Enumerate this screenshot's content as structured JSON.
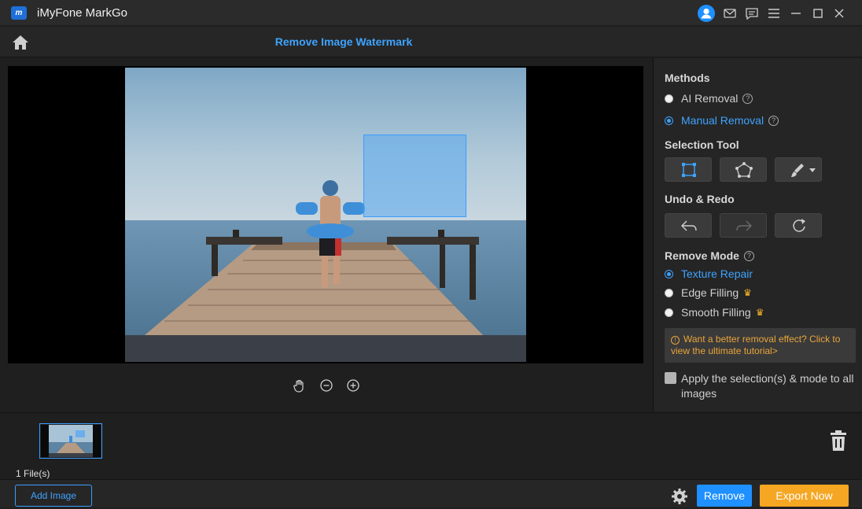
{
  "app": {
    "title": "iMyFone MarkGo",
    "logo_text": "m"
  },
  "header": {
    "title": "Remove Image Watermark"
  },
  "panel": {
    "methods": {
      "title": "Methods",
      "options": [
        {
          "label": "AI Removal",
          "selected": false
        },
        {
          "label": "Manual Removal",
          "selected": true
        }
      ]
    },
    "selection_tool": {
      "title": "Selection Tool",
      "tools": [
        "rectangle-select",
        "polygon-select",
        "brush"
      ]
    },
    "undo_redo": {
      "title": "Undo & Redo"
    },
    "remove_mode": {
      "title": "Remove Mode",
      "options": [
        {
          "label": "Texture Repair",
          "selected": true,
          "premium": false
        },
        {
          "label": "Edge Filling",
          "selected": false,
          "premium": true
        },
        {
          "label": "Smooth Filling",
          "selected": false,
          "premium": true
        }
      ]
    },
    "tip": "Want a better removal effect? Click to view the ultimate tutorial>",
    "apply_all": {
      "label": "Apply the selection(s) & mode to all images",
      "checked": false
    }
  },
  "files": {
    "count_label": "1 File(s)"
  },
  "footer": {
    "add_image": "Add Image",
    "remove": "Remove",
    "export": "Export Now"
  },
  "colors": {
    "accent": "#1e90ff",
    "export": "#f5a623",
    "link": "#3ea3ff",
    "warning": "#e9a53b"
  }
}
